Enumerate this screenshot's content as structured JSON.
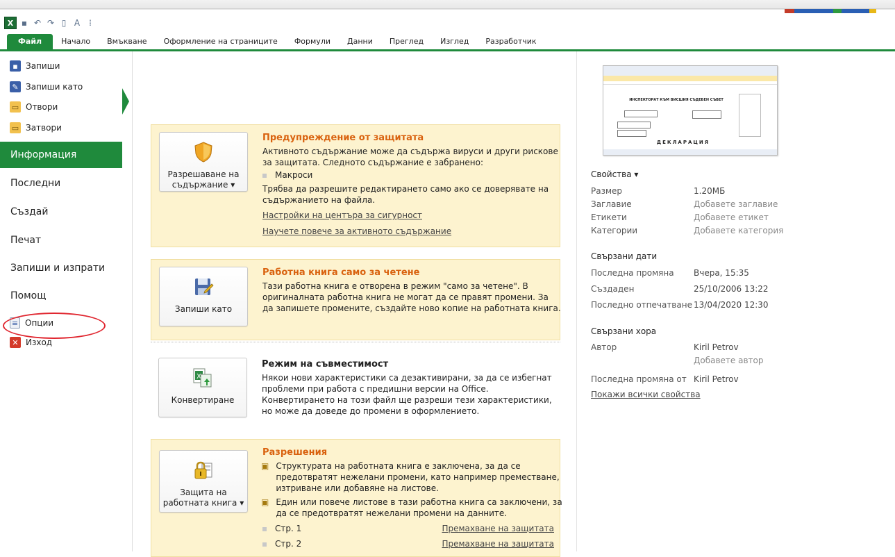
{
  "ribbon": {
    "tabs": [
      "Файл",
      "Начало",
      "Вмъкване",
      "Оформление на страниците",
      "Формули",
      "Данни",
      "Преглед",
      "Изглед",
      "Разработчик"
    ]
  },
  "left": {
    "small_top": [
      "Запиши",
      "Запиши като",
      "Отвори",
      "Затвори"
    ],
    "big": [
      "Информация",
      "Последни",
      "Създай",
      "Печат",
      "Запиши и изпрати",
      "Помощ"
    ],
    "small_bottom": [
      "Опции",
      "Изход"
    ]
  },
  "sections": {
    "protection": {
      "button": "Разрешаване на съдържание ▾",
      "button_line1": "Разрешаване на",
      "button_line2": "съдържание ▾",
      "title": "Предупреждение от защитата",
      "text1": "Активното съдържание може да съдържа вируси и други рискове за защитата. Следното съдържание е забранено:",
      "bullet": "Макроси",
      "text2": "Трябва да разрешите редактирането само ако се доверявате на съдържанието на файла.",
      "link1": "Настройки на центъра за сигурност",
      "link2": "Научете повече за активното съдържание"
    },
    "readonly": {
      "button": "Запиши като",
      "title": "Работна книга само за четене",
      "text": "Тази работна книга е отворена в режим \"само за четене\". В оригиналната работна книга не могат да се правят промени. За да запишете промените, създайте ново копие на работната книга."
    },
    "compat": {
      "button": "Конвертиране",
      "title": "Режим на съвместимост",
      "text": "Някои нови характеристики са дезактивирани, за да се избегнат проблеми при работа с предишни версии на Office. Конвертирането на този файл ще разреши тези характеристики, но може да доведе до промени в оформлението."
    },
    "permissions": {
      "button_line1": "Защита на",
      "button_line2": "работната книга ▾",
      "title": "Разрешения",
      "item1": "Структурата на работната книга е заключена, за да се предотвратят нежелани промени, като например преместване, изтриване или добавяне на листове.",
      "item2": "Един или повече листове в тази работна книга са заключени, за да се предотвратят нежелани промени на данните.",
      "sheet1": "Стр. 1",
      "sheet2": "Стр. 2",
      "remove": "Премахване на защитата"
    }
  },
  "props": {
    "heading": "Свойства ▾",
    "rows": [
      {
        "k": "Размер",
        "v": "1.20МБ"
      },
      {
        "k": "Заглавие",
        "v": "Добавете заглавие"
      },
      {
        "k": "Етикети",
        "v": "Добавете етикет"
      },
      {
        "k": "Категории",
        "v": "Добавете категория"
      }
    ],
    "dates_heading": "Свързани дати",
    "dates": [
      {
        "k": "Последна промяна",
        "v": "Вчера, 15:35"
      },
      {
        "k": "Създаден",
        "v": "25/10/2006 13:22"
      },
      {
        "k": "Последно отпечатване",
        "v": "13/04/2020 12:30"
      }
    ],
    "people_heading": "Свързани хора",
    "author_k": "Автор",
    "author_v": "Kiril Petrov",
    "add_author": "Добавете автор",
    "lastmod_k": "Последна промяна от",
    "lastmod_v": "Kiril Petrov",
    "show_all": "Покажи всички свойства"
  },
  "thumbnail": {
    "heading": "ИНСПЕКТОРАТ КЪМ ВИСШИЯ СЪДЕБЕН СЪВЕТ",
    "title": "ДЕКЛАРАЦИЯ"
  },
  "colors": {
    "accent": "#1f8a3c",
    "warning_bg": "#fdf3cf",
    "title_orange": "#d9620f",
    "highlight": "#e0262f"
  }
}
